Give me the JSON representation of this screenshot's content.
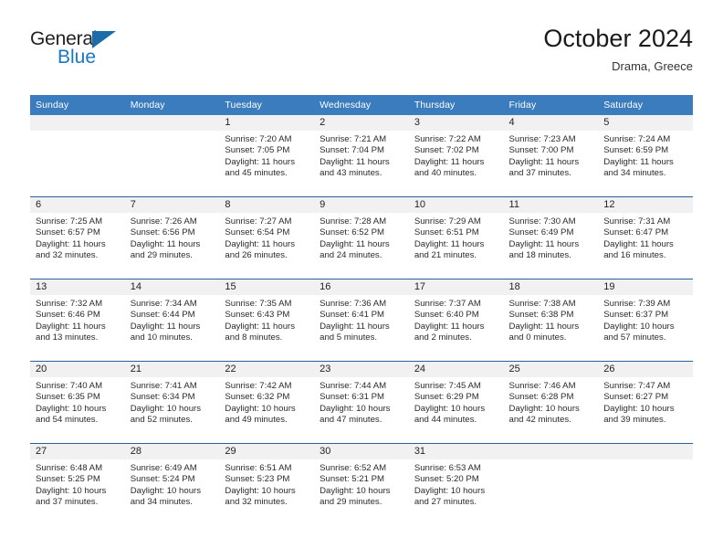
{
  "brand": {
    "name_top": "General",
    "name_bottom": "Blue",
    "accent_color": "#1878c4",
    "triangle_color": "#1b6ca8"
  },
  "header": {
    "title": "October 2024",
    "subtitle": "Drama, Greece"
  },
  "theme": {
    "header_bg": "#3a7cbe",
    "header_text": "#ffffff",
    "row_divider": "#2a6099",
    "daynum_band_bg": "#f1f1f1",
    "cell_bg": "#ffffff"
  },
  "weekday_headers": [
    "Sunday",
    "Monday",
    "Tuesday",
    "Wednesday",
    "Thursday",
    "Friday",
    "Saturday"
  ],
  "labels": {
    "sunrise_prefix": "Sunrise:",
    "sunset_prefix": "Sunset:",
    "daylight_prefix": "Daylight:"
  },
  "weeks": [
    [
      {
        "day": "",
        "sunrise": "",
        "sunset": "",
        "daylight_1": "",
        "daylight_2": ""
      },
      {
        "day": "",
        "sunrise": "",
        "sunset": "",
        "daylight_1": "",
        "daylight_2": ""
      },
      {
        "day": "1",
        "sunrise": "Sunrise: 7:20 AM",
        "sunset": "Sunset: 7:05 PM",
        "daylight_1": "Daylight: 11 hours",
        "daylight_2": "and 45 minutes."
      },
      {
        "day": "2",
        "sunrise": "Sunrise: 7:21 AM",
        "sunset": "Sunset: 7:04 PM",
        "daylight_1": "Daylight: 11 hours",
        "daylight_2": "and 43 minutes."
      },
      {
        "day": "3",
        "sunrise": "Sunrise: 7:22 AM",
        "sunset": "Sunset: 7:02 PM",
        "daylight_1": "Daylight: 11 hours",
        "daylight_2": "and 40 minutes."
      },
      {
        "day": "4",
        "sunrise": "Sunrise: 7:23 AM",
        "sunset": "Sunset: 7:00 PM",
        "daylight_1": "Daylight: 11 hours",
        "daylight_2": "and 37 minutes."
      },
      {
        "day": "5",
        "sunrise": "Sunrise: 7:24 AM",
        "sunset": "Sunset: 6:59 PM",
        "daylight_1": "Daylight: 11 hours",
        "daylight_2": "and 34 minutes."
      }
    ],
    [
      {
        "day": "6",
        "sunrise": "Sunrise: 7:25 AM",
        "sunset": "Sunset: 6:57 PM",
        "daylight_1": "Daylight: 11 hours",
        "daylight_2": "and 32 minutes."
      },
      {
        "day": "7",
        "sunrise": "Sunrise: 7:26 AM",
        "sunset": "Sunset: 6:56 PM",
        "daylight_1": "Daylight: 11 hours",
        "daylight_2": "and 29 minutes."
      },
      {
        "day": "8",
        "sunrise": "Sunrise: 7:27 AM",
        "sunset": "Sunset: 6:54 PM",
        "daylight_1": "Daylight: 11 hours",
        "daylight_2": "and 26 minutes."
      },
      {
        "day": "9",
        "sunrise": "Sunrise: 7:28 AM",
        "sunset": "Sunset: 6:52 PM",
        "daylight_1": "Daylight: 11 hours",
        "daylight_2": "and 24 minutes."
      },
      {
        "day": "10",
        "sunrise": "Sunrise: 7:29 AM",
        "sunset": "Sunset: 6:51 PM",
        "daylight_1": "Daylight: 11 hours",
        "daylight_2": "and 21 minutes."
      },
      {
        "day": "11",
        "sunrise": "Sunrise: 7:30 AM",
        "sunset": "Sunset: 6:49 PM",
        "daylight_1": "Daylight: 11 hours",
        "daylight_2": "and 18 minutes."
      },
      {
        "day": "12",
        "sunrise": "Sunrise: 7:31 AM",
        "sunset": "Sunset: 6:47 PM",
        "daylight_1": "Daylight: 11 hours",
        "daylight_2": "and 16 minutes."
      }
    ],
    [
      {
        "day": "13",
        "sunrise": "Sunrise: 7:32 AM",
        "sunset": "Sunset: 6:46 PM",
        "daylight_1": "Daylight: 11 hours",
        "daylight_2": "and 13 minutes."
      },
      {
        "day": "14",
        "sunrise": "Sunrise: 7:34 AM",
        "sunset": "Sunset: 6:44 PM",
        "daylight_1": "Daylight: 11 hours",
        "daylight_2": "and 10 minutes."
      },
      {
        "day": "15",
        "sunrise": "Sunrise: 7:35 AM",
        "sunset": "Sunset: 6:43 PM",
        "daylight_1": "Daylight: 11 hours",
        "daylight_2": "and 8 minutes."
      },
      {
        "day": "16",
        "sunrise": "Sunrise: 7:36 AM",
        "sunset": "Sunset: 6:41 PM",
        "daylight_1": "Daylight: 11 hours",
        "daylight_2": "and 5 minutes."
      },
      {
        "day": "17",
        "sunrise": "Sunrise: 7:37 AM",
        "sunset": "Sunset: 6:40 PM",
        "daylight_1": "Daylight: 11 hours",
        "daylight_2": "and 2 minutes."
      },
      {
        "day": "18",
        "sunrise": "Sunrise: 7:38 AM",
        "sunset": "Sunset: 6:38 PM",
        "daylight_1": "Daylight: 11 hours",
        "daylight_2": "and 0 minutes."
      },
      {
        "day": "19",
        "sunrise": "Sunrise: 7:39 AM",
        "sunset": "Sunset: 6:37 PM",
        "daylight_1": "Daylight: 10 hours",
        "daylight_2": "and 57 minutes."
      }
    ],
    [
      {
        "day": "20",
        "sunrise": "Sunrise: 7:40 AM",
        "sunset": "Sunset: 6:35 PM",
        "daylight_1": "Daylight: 10 hours",
        "daylight_2": "and 54 minutes."
      },
      {
        "day": "21",
        "sunrise": "Sunrise: 7:41 AM",
        "sunset": "Sunset: 6:34 PM",
        "daylight_1": "Daylight: 10 hours",
        "daylight_2": "and 52 minutes."
      },
      {
        "day": "22",
        "sunrise": "Sunrise: 7:42 AM",
        "sunset": "Sunset: 6:32 PM",
        "daylight_1": "Daylight: 10 hours",
        "daylight_2": "and 49 minutes."
      },
      {
        "day": "23",
        "sunrise": "Sunrise: 7:44 AM",
        "sunset": "Sunset: 6:31 PM",
        "daylight_1": "Daylight: 10 hours",
        "daylight_2": "and 47 minutes."
      },
      {
        "day": "24",
        "sunrise": "Sunrise: 7:45 AM",
        "sunset": "Sunset: 6:29 PM",
        "daylight_1": "Daylight: 10 hours",
        "daylight_2": "and 44 minutes."
      },
      {
        "day": "25",
        "sunrise": "Sunrise: 7:46 AM",
        "sunset": "Sunset: 6:28 PM",
        "daylight_1": "Daylight: 10 hours",
        "daylight_2": "and 42 minutes."
      },
      {
        "day": "26",
        "sunrise": "Sunrise: 7:47 AM",
        "sunset": "Sunset: 6:27 PM",
        "daylight_1": "Daylight: 10 hours",
        "daylight_2": "and 39 minutes."
      }
    ],
    [
      {
        "day": "27",
        "sunrise": "Sunrise: 6:48 AM",
        "sunset": "Sunset: 5:25 PM",
        "daylight_1": "Daylight: 10 hours",
        "daylight_2": "and 37 minutes."
      },
      {
        "day": "28",
        "sunrise": "Sunrise: 6:49 AM",
        "sunset": "Sunset: 5:24 PM",
        "daylight_1": "Daylight: 10 hours",
        "daylight_2": "and 34 minutes."
      },
      {
        "day": "29",
        "sunrise": "Sunrise: 6:51 AM",
        "sunset": "Sunset: 5:23 PM",
        "daylight_1": "Daylight: 10 hours",
        "daylight_2": "and 32 minutes."
      },
      {
        "day": "30",
        "sunrise": "Sunrise: 6:52 AM",
        "sunset": "Sunset: 5:21 PM",
        "daylight_1": "Daylight: 10 hours",
        "daylight_2": "and 29 minutes."
      },
      {
        "day": "31",
        "sunrise": "Sunrise: 6:53 AM",
        "sunset": "Sunset: 5:20 PM",
        "daylight_1": "Daylight: 10 hours",
        "daylight_2": "and 27 minutes."
      },
      {
        "day": "",
        "sunrise": "",
        "sunset": "",
        "daylight_1": "",
        "daylight_2": ""
      },
      {
        "day": "",
        "sunrise": "",
        "sunset": "",
        "daylight_1": "",
        "daylight_2": ""
      }
    ]
  ]
}
